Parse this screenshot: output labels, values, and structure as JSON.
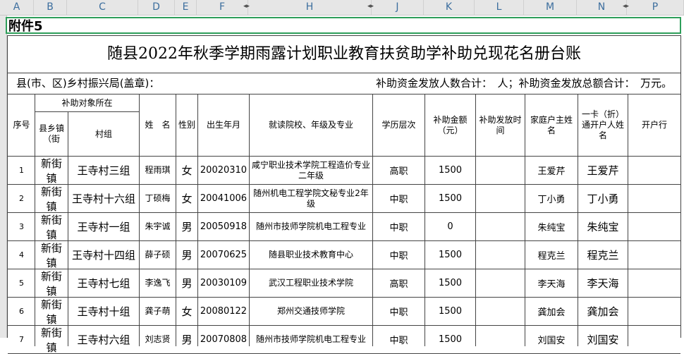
{
  "column_headers": [
    "A",
    "B",
    "C",
    "D",
    "E",
    "F",
    "H",
    "J",
    "K",
    "L",
    "M",
    "N",
    "P"
  ],
  "fujian_label": "附件5",
  "title": "随县2022年秋季学期雨露计划职业教育扶贫助学补助兑现花名册台账",
  "sub_left": "县(市、区)乡村振兴局(盖章)：",
  "sub_right": "补助资金发放人数合计：　人；补助资金发放总额合计：　万元。",
  "headers": {
    "seq": "序号",
    "group": "补助对象所在",
    "town": "县乡镇（街",
    "village": "村组",
    "name": "姓　名",
    "gender": "性别",
    "birth": "出生年月",
    "school": "就读院校、年级及专业",
    "level": "学历层次",
    "amount": "补助金额（元）",
    "time": "补助发放时间",
    "householder": "家庭户主姓名",
    "cardholder": "一卡（折）通开户人姓名",
    "bank": "开户行"
  },
  "rows": [
    {
      "seq": "1",
      "town": "新街镇",
      "village": "王寺村三组",
      "name": "程雨琪",
      "gender": "女",
      "birth": "20020310",
      "school": "咸宁职业技术学院工程造价专业二年级",
      "level": "高职",
      "amount": "1500",
      "time": "",
      "householder": "王爱芹",
      "cardholder": "王爱芹",
      "bank": ""
    },
    {
      "seq": "2",
      "town": "新街镇",
      "village": "王寺村十六组",
      "name": "丁硕梅",
      "gender": "女",
      "birth": "20041006",
      "school": "随州机电工程学院文秘专业2年级",
      "level": "中职",
      "amount": "1500",
      "time": "",
      "householder": "丁小勇",
      "cardholder": "丁小勇",
      "bank": ""
    },
    {
      "seq": "3",
      "town": "新街镇",
      "village": "王寺村一组",
      "name": "朱宇诚",
      "gender": "男",
      "birth": "20050918",
      "school": "随州市技师学院机电工程专业",
      "level": "中职",
      "amount": "0",
      "time": "",
      "householder": "朱纯宝",
      "cardholder": "朱纯宝",
      "bank": ""
    },
    {
      "seq": "4",
      "town": "新街镇",
      "village": "王寺村十四组",
      "name": "薛子硕",
      "gender": "男",
      "birth": "20070625",
      "school": "随县职业技术教育中心",
      "level": "中职",
      "amount": "1500",
      "time": "",
      "householder": "程克兰",
      "cardholder": "程克兰",
      "bank": ""
    },
    {
      "seq": "5",
      "town": "新街镇",
      "village": "王寺村七组",
      "name": "李逸飞",
      "gender": "男",
      "birth": "20030109",
      "school": "武汉工程职业技术学院",
      "level": "高职",
      "amount": "1500",
      "time": "",
      "householder": "李天海",
      "cardholder": "李天海",
      "bank": ""
    },
    {
      "seq": "6",
      "town": "新街镇",
      "village": "王寺村十组",
      "name": "龚子萌",
      "gender": "女",
      "birth": "20080122",
      "school": "郑州交通技师学院",
      "level": "中职",
      "amount": "1500",
      "time": "",
      "householder": "龚加会",
      "cardholder": "龚加会",
      "bank": ""
    },
    {
      "seq": "7",
      "town": "新街镇",
      "village": "王寺村六组",
      "name": "刘志贤",
      "gender": "男",
      "birth": "20070808",
      "school": "随州市技师学院机电工程专业",
      "level": "中职",
      "amount": "1500",
      "time": "",
      "householder": "刘国安",
      "cardholder": "刘国安",
      "bank": ""
    }
  ]
}
